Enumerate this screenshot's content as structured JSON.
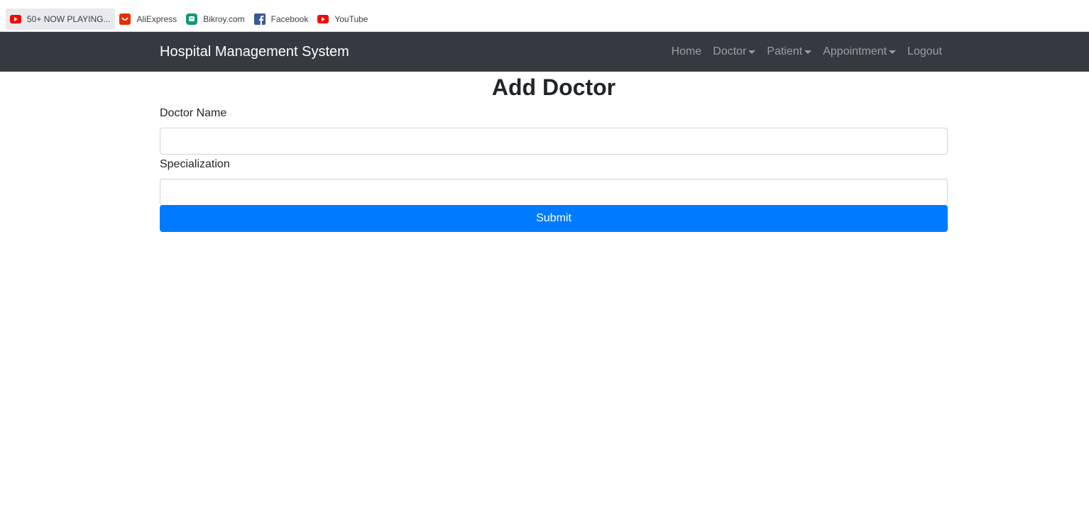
{
  "bookmarks": [
    {
      "label": "50+ NOW PLAYING...",
      "icon": "youtube-icon"
    },
    {
      "label": "AliExpress",
      "icon": "aliexpress-icon"
    },
    {
      "label": "Bikroy.com",
      "icon": "bikroy-icon"
    },
    {
      "label": "Facebook",
      "icon": "facebook-icon"
    },
    {
      "label": "YouTube",
      "icon": "youtube-icon"
    }
  ],
  "navbar": {
    "brand": "Hospital Management System",
    "items": [
      {
        "label": "Home",
        "dropdown": false
      },
      {
        "label": "Doctor",
        "dropdown": true
      },
      {
        "label": "Patient",
        "dropdown": true
      },
      {
        "label": "Appointment",
        "dropdown": true
      },
      {
        "label": "Logout",
        "dropdown": false
      }
    ]
  },
  "form": {
    "title": "Add Doctor",
    "doctor_name_label": "Doctor Name",
    "doctor_name_value": "",
    "specialization_label": "Specialization",
    "specialization_value": "",
    "submit_label": "Submit"
  },
  "colors": {
    "navbar_bg": "#343a40",
    "primary": "#007bff",
    "youtube_red": "#ff0000",
    "aliexpress_red": "#e62e04",
    "bikroy_green": "#149777",
    "facebook_blue": "#1877f2"
  }
}
